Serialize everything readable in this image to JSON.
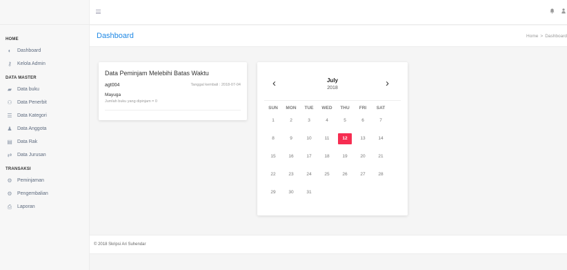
{
  "sidebar": {
    "sections": [
      {
        "title": "HOME",
        "items": [
          {
            "label": "Dashboard",
            "icon": "gauge-icon"
          },
          {
            "label": "Kelola Admin",
            "icon": "key-icon"
          }
        ]
      },
      {
        "title": "DATA MASTER",
        "items": [
          {
            "label": "Data buku",
            "icon": "book-icon"
          },
          {
            "label": "Data Penerbit",
            "icon": "users-icon"
          },
          {
            "label": "Data Kategori",
            "icon": "list-icon"
          },
          {
            "label": "Data Anggota",
            "icon": "user-icon"
          },
          {
            "label": "Data Rak",
            "icon": "shelf-icon"
          },
          {
            "label": "Data Jurusan",
            "icon": "exchange-icon"
          }
        ]
      },
      {
        "title": "TRANSAKSI",
        "items": [
          {
            "label": "Peminjaman",
            "icon": "cog-icon"
          },
          {
            "label": "Pengembalian",
            "icon": "cog-icon"
          },
          {
            "label": "Laporan",
            "icon": "printer-icon"
          }
        ]
      }
    ]
  },
  "topbar": {
    "hamburger_icon": "≡",
    "bell_icon": "🔔",
    "user_icon": "👤"
  },
  "header": {
    "title": "Dashboard",
    "breadcrumb": {
      "home": "Home",
      "separator": ">",
      "current": "Dashboard"
    }
  },
  "loan_card": {
    "title": "Data Peminjam Melebihi Batas Waktu",
    "code": "agt004",
    "return_date": "Tanggal kembali : 2018-07-04",
    "name": "Mayuga",
    "count": "Jumlah buku yang dipinjam = 0"
  },
  "calendar": {
    "prev": "‹",
    "next": "›",
    "month": "July",
    "year": "2018",
    "weekdays": [
      "SUN",
      "MON",
      "TUE",
      "WED",
      "THU",
      "FRI",
      "SAT"
    ],
    "weeks": [
      [
        "1",
        "2",
        "3",
        "4",
        "5",
        "6",
        "7"
      ],
      [
        "8",
        "9",
        "10",
        "11",
        "12",
        "13",
        "14"
      ],
      [
        "15",
        "16",
        "17",
        "18",
        "19",
        "20",
        "21"
      ],
      [
        "22",
        "23",
        "24",
        "25",
        "26",
        "27",
        "28"
      ],
      [
        "29",
        "30",
        "31",
        "",
        "",
        "",
        ""
      ]
    ],
    "today": "12",
    "today_color": "#f62d51"
  },
  "footer": {
    "text": "© 2018 Skripsi Ari Suhendar"
  },
  "colors": {
    "accent": "#1e88e5",
    "today": "#f62d51"
  }
}
